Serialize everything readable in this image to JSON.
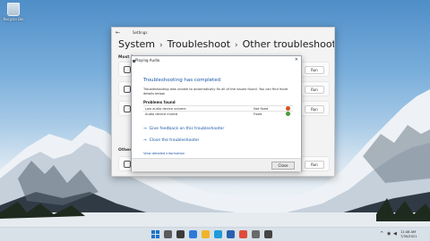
{
  "desktop": {
    "recycle_bin_label": "Recycle Bin"
  },
  "settings": {
    "window_title": "Settings",
    "breadcrumb": [
      "System",
      "Troubleshoot",
      "Other troubleshooters"
    ],
    "section_most": "Most fr",
    "section_other": "Other",
    "run_label": "Run"
  },
  "dialog": {
    "title": "Playing Audio",
    "heading": "Troubleshooting has completed",
    "description": "Troubleshooting was unable to automatically fix all of the issues found. You can find more details below.",
    "problems_label": "Problems found",
    "problems": [
      {
        "name": "Low audio device volume",
        "status": "Not fixed",
        "state": "bad"
      },
      {
        "name": "Audio device muted",
        "status": "Fixed",
        "state": "ok"
      }
    ],
    "feedback_link": "Give feedback on this troubleshooter",
    "close_link": "Close the troubleshooter",
    "more_info": "View detailed information",
    "close_button": "Close"
  },
  "taskbar": {
    "time": "11:48 AM",
    "date": "7/30/2021",
    "chevron": "^",
    "colors": {
      "start": "#1a73c8",
      "search": "#5b5b5b",
      "taskview": "#3a3a3a",
      "widgets": "#2d7ad6",
      "explorer": "#f0b429",
      "edge": "#1f9bd8",
      "store": "#2a5fb0",
      "chrome": "#e04a3a",
      "settings": "#6a6a6a",
      "app": "#444444"
    }
  }
}
